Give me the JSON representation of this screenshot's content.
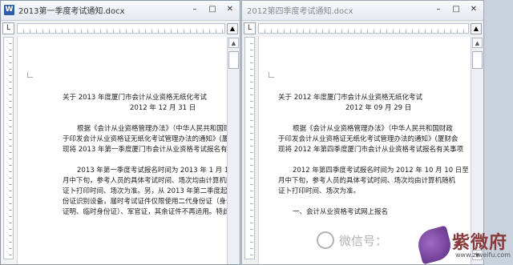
{
  "windows": {
    "left": {
      "title": "2013第一季度考试通知.docx",
      "app_icon_letter": "W",
      "controls": [
        "–",
        "□",
        "✕"
      ],
      "ruler_tab": "L",
      "ruler_end": "▲",
      "lines": [
        "关于 2013 年度厦门市会计从业资格无纸化考试",
        "2012 年 12 月 31 日",
        "根据《会计从业资格管理办法》（中华人民共和国财政",
        "于印发会计从业资格证无纸化考试管理办法的通知》(厦财会",
        "现将 2013 年第一季度厦门市会计从业资格考试报名有关事",
        "2013 年第一季度考试报名时间为 2013 年 1 月 10 日至",
        "月中下旬，参考人员的具体考试时间、场次均由计算机随机",
        "证卜打印时间、场次为准。另，从 2013 年第二季度起，会",
        "份证识别设备，届时考试证件仅限使用二代身份证（身份证",
        "证明、临时身份证）、军官证，其余证件不再适用。特此通"
      ]
    },
    "right": {
      "title": "2012第四季度考试通知.docx",
      "controls": [
        "–",
        "□",
        "✕"
      ],
      "ruler_tab": "L",
      "ruler_end": "▲",
      "lines": [
        "关于 2012 年度厦门市会计从业资格无纸化考试",
        "2012 年 09 月 29 日",
        "根据《会计从业资格管理办法》（中华人民共和国财政",
        "于印发会计从业资格证无纸化考试管理办法的通知》(厦财会",
        "现将 2012 年第四季度厦门市会计从业资格考试报名有关事项",
        "2012 年第四季度考试报名时间为 2012 年 10 月 10 日至",
        "月中下旬，参考人员的具体考试时间、场次均由计算机随机",
        "证卜打印时间、场次为准。",
        "一、会计从业资格考试网上报名"
      ]
    }
  },
  "watermark": {
    "text": "微信号："
  },
  "brand": {
    "name": "紫微府",
    "url": "www.ziweifu.com"
  }
}
